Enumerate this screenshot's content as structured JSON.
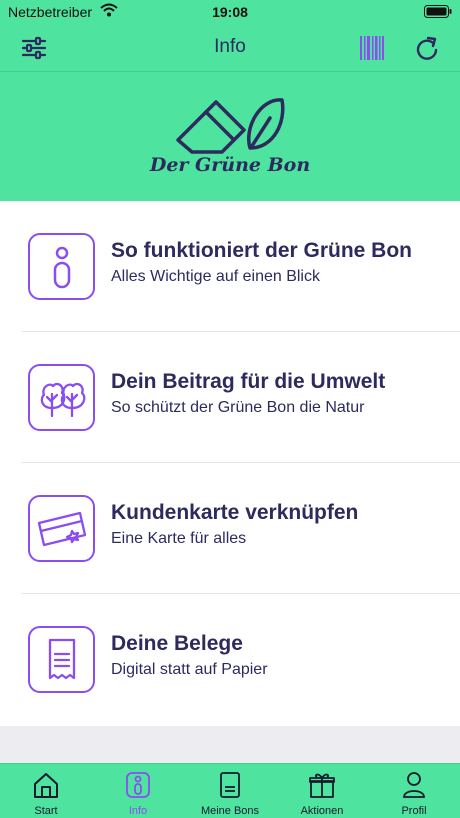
{
  "status_bar": {
    "carrier": "Netzbetreiber",
    "time": "19:08"
  },
  "nav": {
    "title": "Info"
  },
  "hero": {
    "brand": "Der Grüne Bon"
  },
  "items": [
    {
      "title": "So funktioniert der Grüne Bon",
      "subtitle": "Alles Wichtige auf einen Blick",
      "icon": "info-icon"
    },
    {
      "title": "Dein Beitrag für die Umwelt",
      "subtitle": "So schützt der Grüne Bon die Natur",
      "icon": "trees-icon"
    },
    {
      "title": "Kundenkarte verknüpfen",
      "subtitle": "Eine Karte für alles",
      "icon": "loyalty-card-icon"
    },
    {
      "title": "Deine Belege",
      "subtitle": "Digital statt auf Papier",
      "icon": "receipt-icon"
    }
  ],
  "tabs": [
    {
      "label": "Start",
      "icon": "home-icon"
    },
    {
      "label": "Info",
      "icon": "info-icon",
      "active": true
    },
    {
      "label": "Meine Bons",
      "icon": "receipt-icon"
    },
    {
      "label": "Aktionen",
      "icon": "gift-icon"
    },
    {
      "label": "Profil",
      "icon": "person-icon"
    }
  ],
  "colors": {
    "brand_green": "#4ee39f",
    "accent_purple": "#8a4df0",
    "text_dark": "#2d2a5e"
  }
}
